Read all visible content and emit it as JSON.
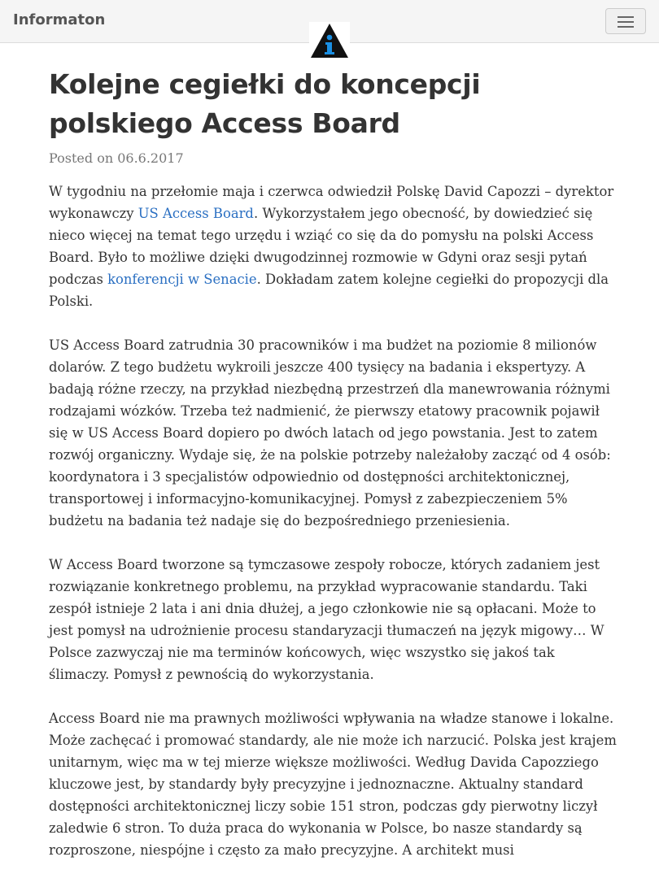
{
  "navbar": {
    "brand": "Informaton",
    "logo_icon": "info-triangle-logo",
    "menu_icon": "hamburger-icon"
  },
  "article": {
    "title": "Kolejne cegiełki do koncepcji polskiego Access Board",
    "posted_label": "Posted on",
    "date": "06.6.2017",
    "p1": {
      "a": "W tygodniu na przełomie maja i czerwca odwiedził Polskę David Capozzi – dyrektor wykonawczy ",
      "link1": "US Access Board",
      "b": ". Wykorzystałem jego obecność, by dowiedzieć się nieco więcej na temat tego urzędu i wziąć co się da do pomysłu na polski Access Board. Było to możliwe dzięki dwugodzinnej rozmowie w Gdyni oraz sesji pytań podczas ",
      "link2": "konferencji w Senacie",
      "c": ". Dokładam zatem kolejne cegiełki do propozycji dla Polski."
    },
    "p2": "US Access Board zatrudnia 30 pracowników i ma budżet na poziomie 8 milionów dolarów. Z tego budżetu wykroili jeszcze 400 tysięcy na badania i ekspertyzy. A badają różne rzeczy, na przykład niezbędną przestrzeń dla manewrowania różnymi rodzajami wózków. Trzeba też nadmienić, że pierwszy etatowy pracownik pojawił się w US Access Board dopiero po dwóch latach od jego powstania. Jest to zatem rozwój organiczny. Wydaje się, że na polskie potrzeby należałoby zacząć od 4 osób: koordynatora i 3 specjalistów odpowiednio od dostępności architektonicznej, transportowej i informacyjno-komunikacyjnej. Pomysł z zabezpieczeniem 5% budżetu na badania też nadaje się do bezpośredniego przeniesienia.",
    "p3": "W Access Board tworzone są tymczasowe zespoły robocze, których zadaniem jest rozwiązanie konkretnego problemu, na przykład wypracowanie standardu. Taki zespół istnieje 2 lata i ani dnia dłużej, a jego członkowie nie są opłacani. Może to jest pomysł na udrożnienie procesu standaryzacji tłumaczeń na język migowy… W Polsce zazwyczaj nie ma terminów końcowych, więc wszystko się jakoś tak ślimaczy. Pomysł z pewnością do wykorzystania.",
    "p4": "Access Board nie ma prawnych możliwości wpływania na władze stanowe i lokalne. Może zachęcać i promować standardy, ale nie może ich narzucić. Polska jest krajem unitarnym, więc ma w tej mierze większe możliwości. Według Davida Capozziego kluczowe jest, by standardy były precyzyjne i jednoznaczne. Aktualny standard dostępności architektonicznej liczy sobie 151 stron, podczas gdy pierwotny liczył zaledwie 6 stron. To duża praca do wykonania w Polsce, bo nasze standardy są rozproszone, niespójne i często za mało precyzyjne. A architekt musi"
  },
  "colors": {
    "link": "#2a6fc2",
    "logo_triangle": "#111111",
    "logo_i": "#1a8fe3"
  }
}
